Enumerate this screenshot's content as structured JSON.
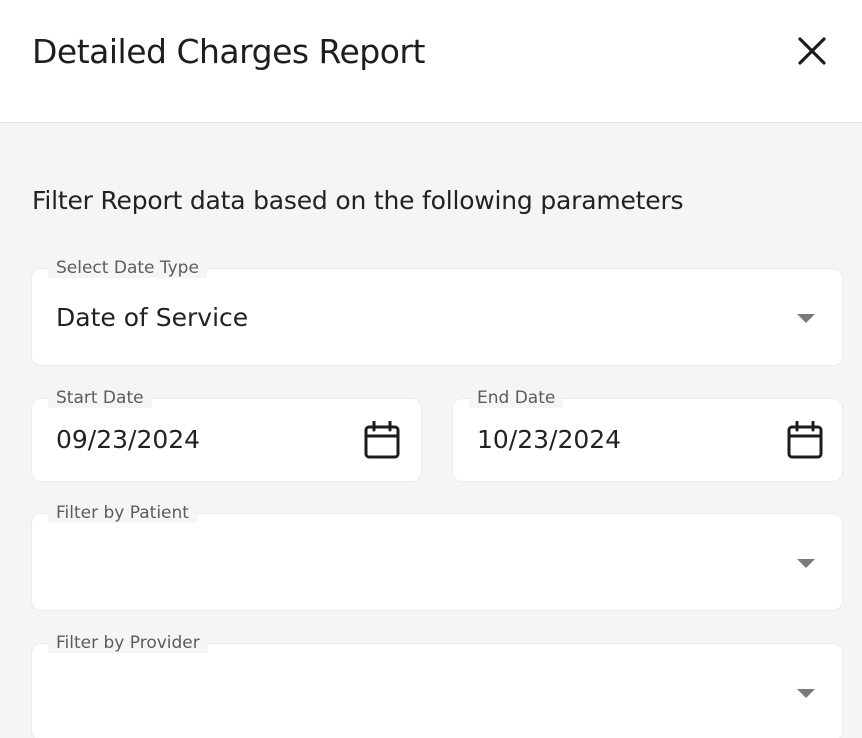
{
  "header": {
    "title": "Detailed Charges Report",
    "close_icon": "close-icon"
  },
  "filters": {
    "subtitle": "Filter Report data based on the following parameters",
    "date_type": {
      "label": "Select Date Type",
      "value": "Date of Service",
      "icon": "chevron-down-icon"
    },
    "start_date": {
      "label": "Start Date",
      "value": "09/23/2024",
      "icon": "calendar-icon"
    },
    "end_date": {
      "label": "End Date",
      "value": "10/23/2024",
      "icon": "calendar-icon"
    },
    "patient": {
      "label": "Filter by Patient",
      "value": "",
      "icon": "chevron-down-icon"
    },
    "provider": {
      "label": "Filter by Provider",
      "value": "",
      "icon": "chevron-down-icon"
    }
  },
  "colors": {
    "header_bg": "#ffffff",
    "body_bg": "#f5f5f5",
    "field_bg": "#ffffff",
    "label_text": "#5c5c5c",
    "icon": "#1c1c1c",
    "caret": "#7a7a7a"
  }
}
